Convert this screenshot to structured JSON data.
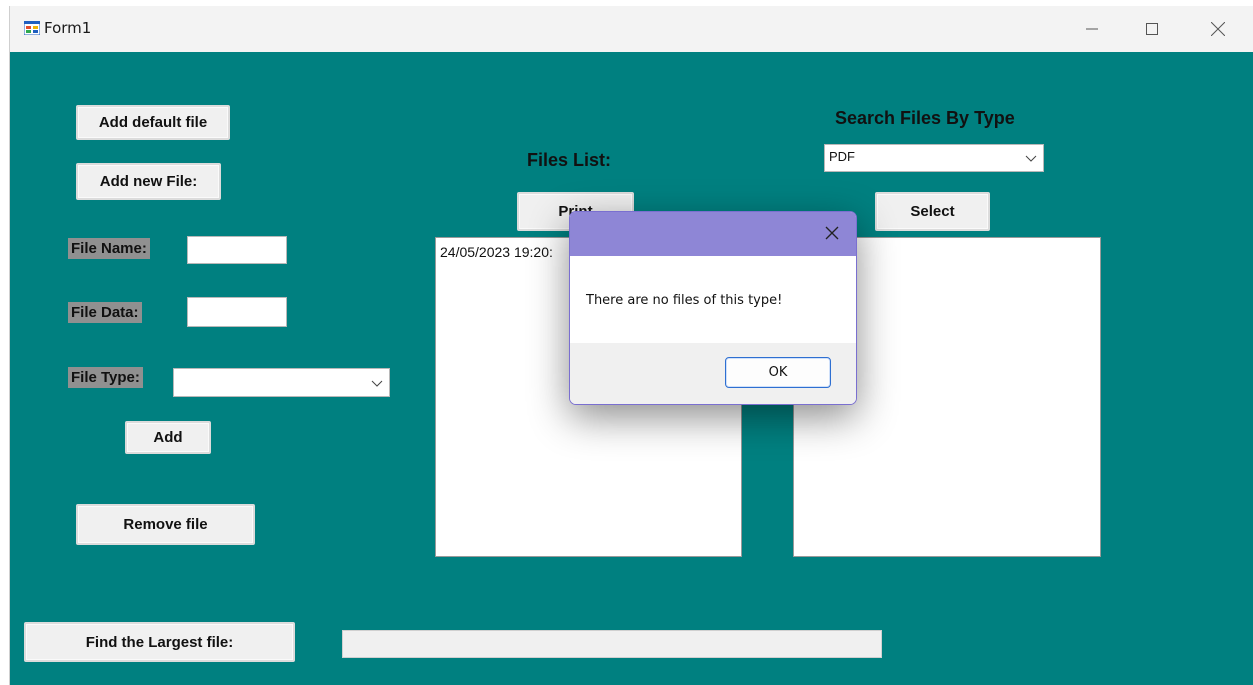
{
  "window": {
    "title": "Form1"
  },
  "icons": {
    "app": "form-app-icon",
    "minimize": "minimize-icon",
    "maximize": "maximize-icon",
    "close": "close-icon",
    "dropdown": "chevron-down-icon"
  },
  "buttons": {
    "add_default_file": "Add default file",
    "add_new_file": "Add new File:",
    "add": "Add",
    "remove_file": "Remove file",
    "find_largest_file": "Find the Largest file:",
    "print": "Print",
    "select": "Select"
  },
  "labels": {
    "file_name": "File Name:",
    "file_data": "File Data:",
    "file_type": "File Type:",
    "files_list": "Files List:",
    "search_files_by_type": "Search Files By Type"
  },
  "inputs": {
    "file_name": {
      "value": ""
    },
    "file_data": {
      "value": ""
    },
    "file_type": {
      "selected": ""
    },
    "search_type": {
      "selected": "PDF"
    },
    "largest_file_result": {
      "value": ""
    }
  },
  "lists": {
    "files_list": [
      "24/05/2023 19:20:"
    ],
    "search_results": []
  },
  "dialog": {
    "message": "There are no files of this type!",
    "ok_label": "OK"
  },
  "colors": {
    "form_background": "#008080",
    "dialog_title": "#8e86d6",
    "label_background": "#909090"
  }
}
